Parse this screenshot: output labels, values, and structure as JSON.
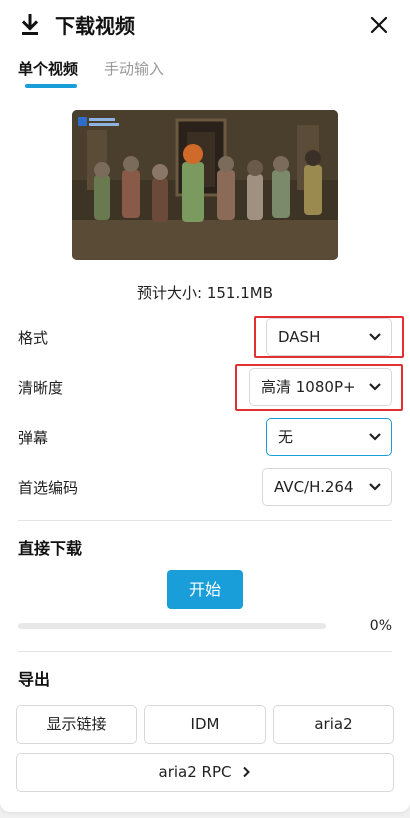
{
  "header": {
    "title": "下载视频",
    "download_icon": "download-icon",
    "close_icon": "close-icon"
  },
  "tabs": [
    {
      "label": "单个视频",
      "active": true
    },
    {
      "label": "手动输入",
      "active": false
    }
  ],
  "video": {
    "thumbnail": "video-thumbnail",
    "size_label": "预计大小: 151.1MB"
  },
  "options": {
    "format": {
      "label": "格式",
      "value": "DASH"
    },
    "quality": {
      "label": "清晰度",
      "value": "高清 1080P+"
    },
    "danmaku": {
      "label": "弹幕",
      "value": "无"
    },
    "codec": {
      "label": "首选编码",
      "value": "AVC/H.264"
    }
  },
  "direct_download": {
    "title": "直接下载",
    "start_label": "开始",
    "progress": 0,
    "progress_text": "0%"
  },
  "export": {
    "title": "导出",
    "buttons": [
      "显示链接",
      "IDM",
      "aria2"
    ],
    "rpc_label": "aria2 RPC"
  },
  "colors": {
    "accent": "#1a9ed9",
    "highlight": "#e0302f"
  }
}
